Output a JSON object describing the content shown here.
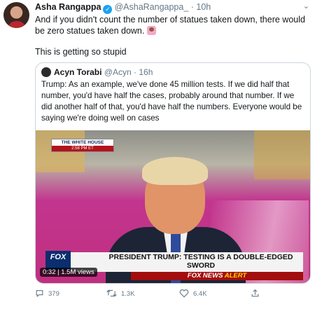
{
  "tweet": {
    "author_name": "Asha Rangappa",
    "handle": "@AshaRangappa_",
    "time": "10h",
    "text_line1": "And if you didn't count the number of statues taken down, there would be zero statues taken down.",
    "text_line2": "This is getting so stupid"
  },
  "quoted": {
    "author_name": "Acyn Torabi",
    "handle": "@Acyn",
    "time": "16h",
    "text": "Trump: As an example, we've done 45 million tests. If we did half that number, you'd have half the cases, probably around that number. If we did another half of that, you'd have half the numbers. Everyone would be saying we're doing well on cases",
    "video": {
      "bug_title": "THE WHITE HOUSE",
      "bug_time": "2:58 PM ET",
      "logo": "FOX",
      "chyron": "PRESIDENT TRUMP: TESTING IS A DOUBLE-EDGED SWORD",
      "alert_brand": "FOX NEWS",
      "alert_word": "ALERT",
      "views_label": "0:32 | 1.5M views"
    }
  },
  "actions": {
    "replies": "379",
    "retweets": "1.3K",
    "likes": "6.4K"
  },
  "colors": {
    "verified": "#1da1f2",
    "muted": "#657786",
    "alert_red": "#a30e0e"
  }
}
